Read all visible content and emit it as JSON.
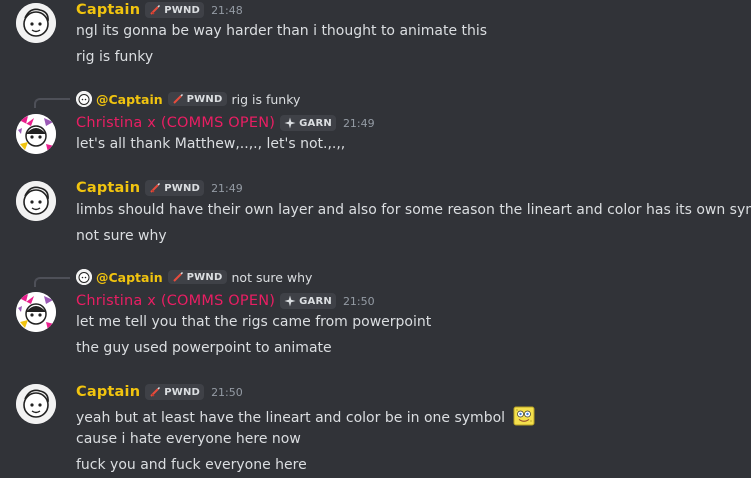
{
  "colors": {
    "background": "#313338",
    "captain_name": "#f1c40f",
    "christina_name": "#e91e63",
    "timestamp": "#949ba4"
  },
  "messages": [
    {
      "author": "Captain",
      "tag": "PWND",
      "tag_icon": "sword-icon",
      "time": "21:48",
      "lines": [
        "ngl its gonna be way harder than i thought to animate this",
        "rig is funky"
      ]
    },
    {
      "reply": {
        "name": "@Captain",
        "tag": "PWND",
        "text": "rig is funky"
      },
      "author": "Christina x (COMMS OPEN)",
      "tag": "GARN",
      "tag_icon": "sparkle-icon",
      "time": "21:49",
      "lines": [
        "let's all thank Matthew,..,., let's not.,.,,"
      ]
    },
    {
      "author": "Captain",
      "tag": "PWND",
      "tag_icon": "sword-icon",
      "time": "21:49",
      "lines": [
        "limbs should have their own layer and also for some reason the lineart and color has its own symbol",
        "not sure why"
      ]
    },
    {
      "reply": {
        "name": "@Captain",
        "tag": "PWND",
        "text": "not sure why"
      },
      "author": "Christina x (COMMS OPEN)",
      "tag": "GARN",
      "tag_icon": "sparkle-icon",
      "time": "21:50",
      "lines": [
        "let me tell you that the rigs came from powerpoint",
        "the guy used powerpoint to animate"
      ]
    },
    {
      "author": "Captain",
      "tag": "PWND",
      "tag_icon": "sword-icon",
      "time": "21:50",
      "lines": [
        "yeah but at least have the lineart and color be in one symbol",
        "cause i hate everyone here now",
        "fuck you and fuck everyone here"
      ],
      "emoji": "spongebob-emoji"
    }
  ]
}
